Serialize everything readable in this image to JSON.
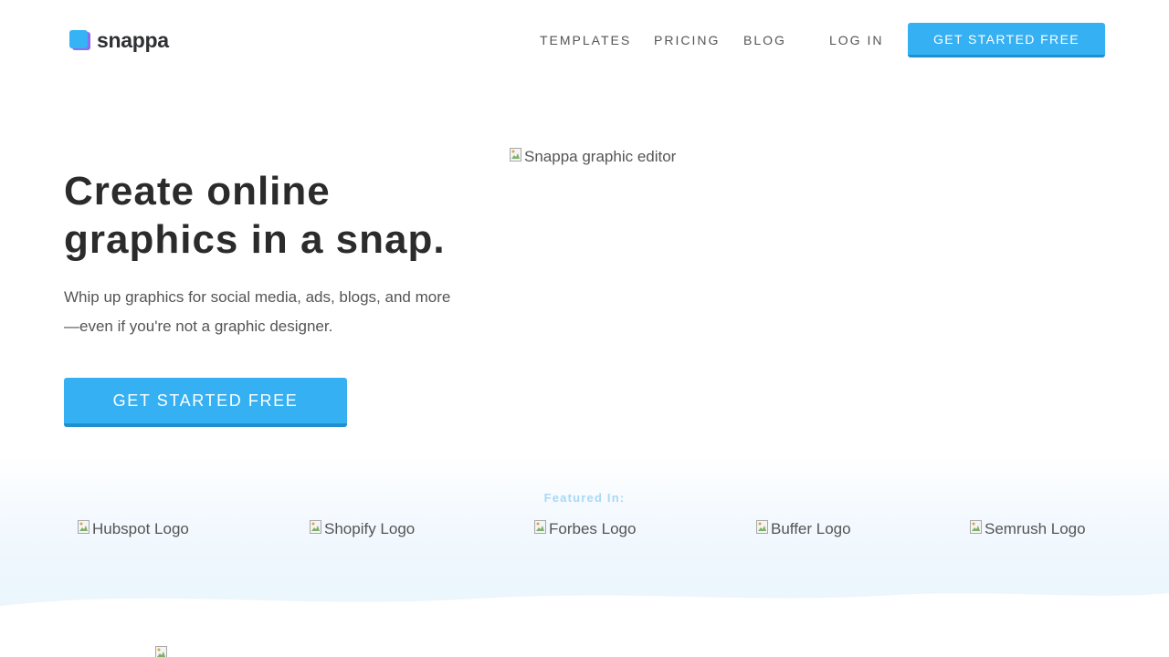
{
  "header": {
    "logo_text": "snappa",
    "nav": [
      {
        "label": "TEMPLATES"
      },
      {
        "label": "PRICING"
      },
      {
        "label": "BLOG"
      },
      {
        "label": "LOG IN"
      }
    ],
    "cta_label": "GET STARTED FREE"
  },
  "hero": {
    "title_line1": "Create online",
    "title_line2": "graphics in a snap.",
    "subtitle_line1": "Whip up graphics for social media, ads, blogs, and more",
    "subtitle_line2": "—even if you're not a graphic designer.",
    "cta_label": "GET STARTED FREE",
    "image_alt": "Snappa graphic editor"
  },
  "featured": {
    "label": "Featured In:",
    "logos": [
      {
        "alt": "Hubspot Logo"
      },
      {
        "alt": "Shopify Logo"
      },
      {
        "alt": "Forbes Logo"
      },
      {
        "alt": "Buffer Logo"
      },
      {
        "alt": "Semrush Logo"
      }
    ]
  },
  "colors": {
    "accent": "#35b0f2",
    "accent_dark": "#1f8fd0",
    "featured_label": "#a9d8f5",
    "logo_purple": "#8e6cf0"
  }
}
